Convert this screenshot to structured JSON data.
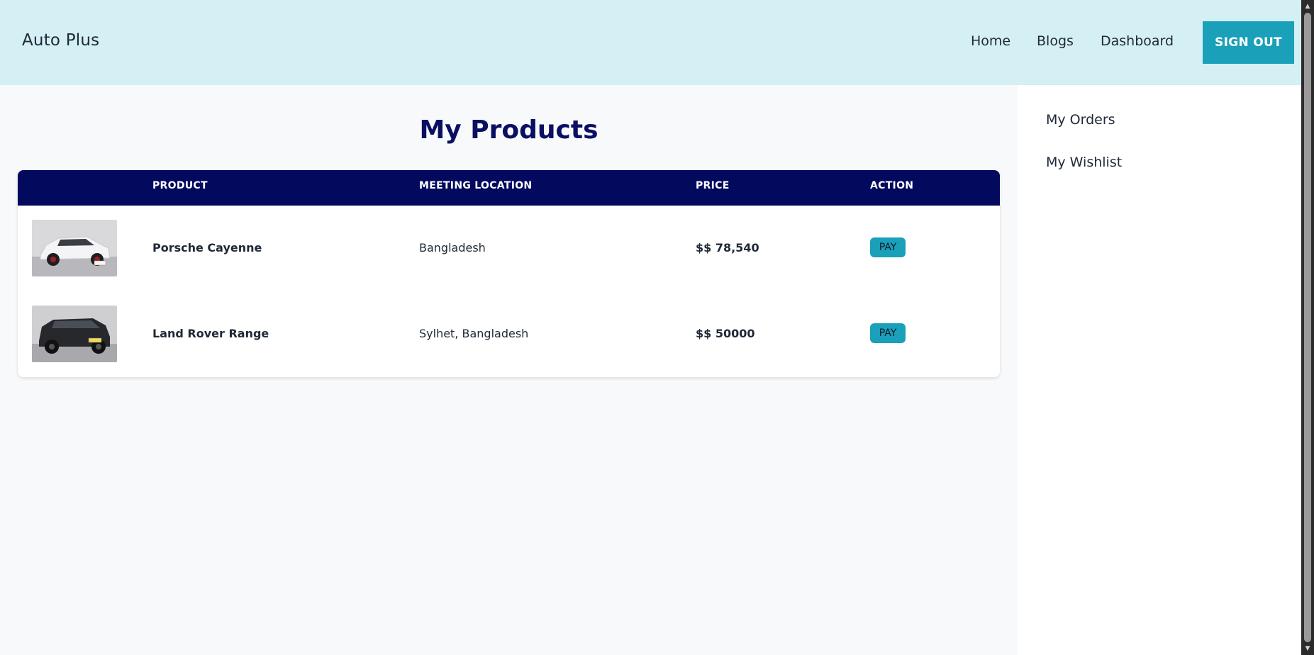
{
  "navbar": {
    "brand": "Auto Plus",
    "links": [
      "Home",
      "Blogs",
      "Dashboard"
    ],
    "signout_label": "SIGN OUT",
    "background": "#d4f0f4",
    "accent": "#1aa0b8"
  },
  "sidebar": {
    "items": [
      "My Orders",
      "My Wishlist"
    ]
  },
  "main": {
    "title": "My Products",
    "table": {
      "headers": [
        "PRODUCT",
        "MEETING LOCATION",
        "PRICE",
        "ACTION"
      ],
      "rows": [
        {
          "product": "Porsche Cayenne",
          "location": "Bangladesh",
          "price": "$$ 78,540",
          "action": "PAY",
          "image": "white-suv-photo"
        },
        {
          "product": "Land Rover Range",
          "location": "Sylhet, Bangladesh",
          "price": "$$ 50000",
          "action": "PAY",
          "image": "black-suv-photo"
        }
      ]
    }
  }
}
